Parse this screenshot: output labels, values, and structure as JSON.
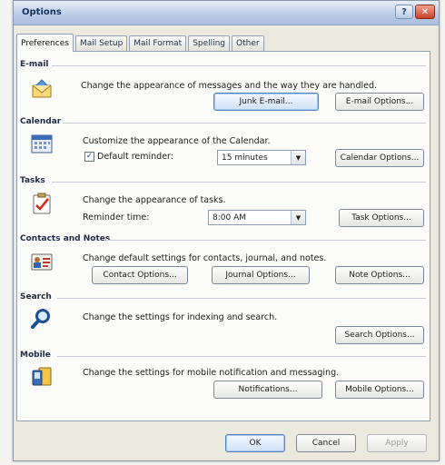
{
  "window": {
    "title": "Options"
  },
  "tabs": [
    "Preferences",
    "Mail Setup",
    "Mail Format",
    "Spelling",
    "Other"
  ],
  "email": {
    "label": "E-mail",
    "description": "Change the appearance of messages and the way they are handled.",
    "junk_button": "Junk E-mail...",
    "options_button": "E-mail Options..."
  },
  "calendar": {
    "label": "Calendar",
    "description": "Customize the appearance of the Calendar.",
    "reminder_label": "Default reminder:",
    "reminder_value": "15 minutes",
    "options_button": "Calendar Options..."
  },
  "tasks": {
    "label": "Tasks",
    "description": "Change the appearance of tasks.",
    "reminder_label": "Reminder time:",
    "reminder_value": "8:00 AM",
    "options_button": "Task Options..."
  },
  "contacts": {
    "label": "Contacts and Notes",
    "description": "Change default settings for contacts, journal, and notes.",
    "contact_button": "Contact Options...",
    "journal_button": "Journal Options...",
    "note_button": "Note Options..."
  },
  "search": {
    "label": "Search",
    "description": "Change the settings for indexing and search.",
    "options_button": "Search Options..."
  },
  "mobile": {
    "label": "Mobile",
    "description": "Change the settings for mobile notification and messaging.",
    "notifications_button": "Notifications...",
    "options_button": "Mobile Options..."
  },
  "footer": {
    "ok": "OK",
    "cancel": "Cancel",
    "apply": "Apply"
  }
}
